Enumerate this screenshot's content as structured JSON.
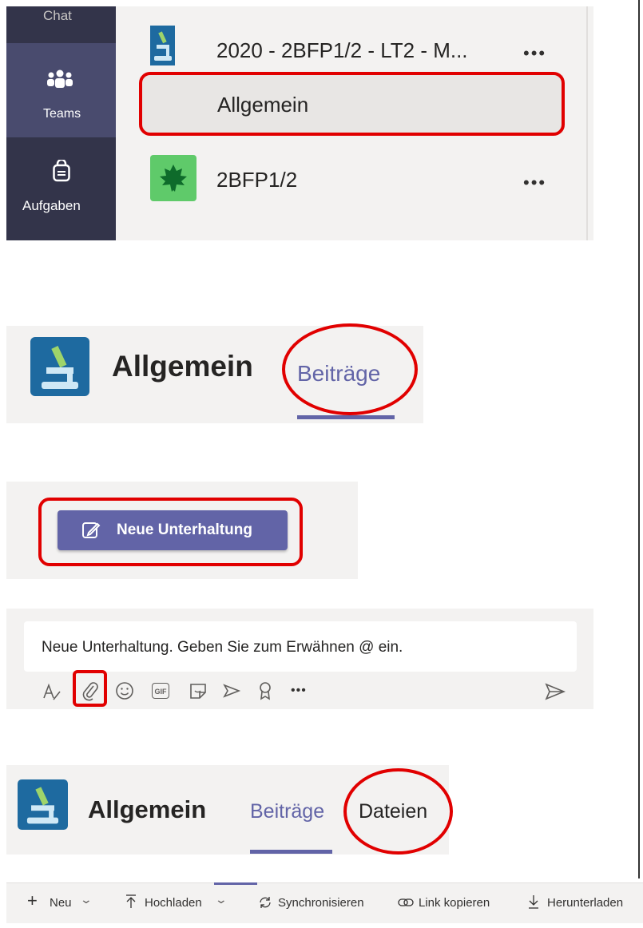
{
  "rail": {
    "items": [
      {
        "label": "Chat",
        "icon": "chat-icon"
      },
      {
        "label": "Teams",
        "icon": "teams-icon",
        "active": true
      },
      {
        "label": "Aufgaben",
        "icon": "assignments-icon"
      }
    ]
  },
  "teams_list": {
    "team1": {
      "name": "2020 - 2BFP1/2 - LT2 - M...",
      "more": "•••"
    },
    "channel": {
      "name": "Allgemein"
    },
    "team2": {
      "name": "2BFP1/2",
      "more": "•••"
    }
  },
  "channel_header_1": {
    "title": "Allgemein",
    "tab_posts": "Beiträge"
  },
  "new_conversation": {
    "button_label": "Neue Unterhaltung"
  },
  "compose": {
    "placeholder": "Neue Unterhaltung. Geben Sie zum Erwähnen @ ein.",
    "tools": [
      "format-icon",
      "attach-icon",
      "emoji-icon",
      "gif-icon",
      "sticker-icon",
      "meet-icon",
      "praise-icon",
      "more-icon"
    ],
    "gif_label": "GIF",
    "more_label": "•••"
  },
  "channel_header_2": {
    "title": "Allgemein",
    "tab_posts": "Beiträge",
    "tab_files": "Dateien"
  },
  "files_toolbar": {
    "new": "Neu",
    "upload": "Hochladen",
    "sync": "Synchronisieren",
    "copy_link": "Link kopieren",
    "download": "Herunterladen"
  },
  "colors": {
    "accent": "#6264a7",
    "highlight": "#e10000",
    "rail": "#33344a"
  }
}
